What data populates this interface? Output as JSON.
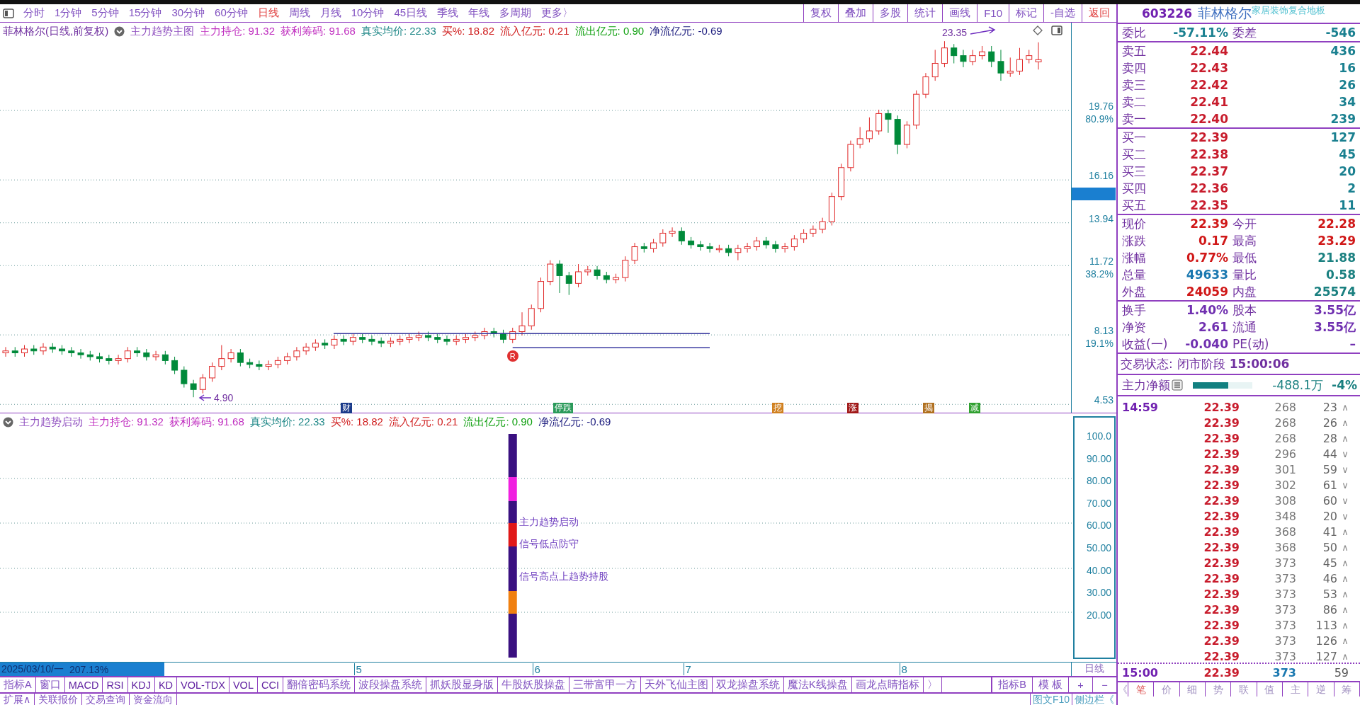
{
  "toolbar": {
    "periods": [
      {
        "label": "分时",
        "selected": false
      },
      {
        "label": "1分钟",
        "selected": false
      },
      {
        "label": "5分钟",
        "selected": false
      },
      {
        "label": "15分钟",
        "selected": false
      },
      {
        "label": "30分钟",
        "selected": false
      },
      {
        "label": "60分钟",
        "selected": false
      },
      {
        "label": "日线",
        "selected": true
      },
      {
        "label": "周线",
        "selected": false
      },
      {
        "label": "月线",
        "selected": false
      },
      {
        "label": "10分钟",
        "selected": false
      },
      {
        "label": "45日线",
        "selected": false
      },
      {
        "label": "季线",
        "selected": false
      },
      {
        "label": "年线",
        "selected": false
      },
      {
        "label": "多周期",
        "selected": false
      },
      {
        "label": "更多〉",
        "selected": false
      }
    ],
    "buttons": [
      {
        "label": "复权",
        "kind": "normal"
      },
      {
        "label": "叠加",
        "kind": "normal"
      },
      {
        "label": "多股",
        "kind": "normal"
      },
      {
        "label": "统计",
        "kind": "normal"
      },
      {
        "label": "画线",
        "kind": "normal"
      },
      {
        "label": "F10",
        "kind": "normal"
      },
      {
        "label": "标记",
        "kind": "normal"
      },
      {
        "label": "-自选",
        "kind": "normal"
      },
      {
        "label": "返回",
        "kind": "back"
      }
    ]
  },
  "stock": {
    "code": "603226",
    "name": "菲林格尔",
    "sector": "家居装饰复合地板"
  },
  "main_chart": {
    "title": "菲林格尔(日线,前复权)",
    "indicator": "主力趋势主图",
    "values": [
      {
        "label": "主力持仓:",
        "value": "91.32",
        "color": "#c030c0"
      },
      {
        "label": "获利筹码:",
        "value": "91.68",
        "color": "#c030c0"
      },
      {
        "label": "真实均价:",
        "value": "22.33",
        "color": "#208888"
      },
      {
        "label": "买%:",
        "value": "18.82",
        "color": "#d02020"
      },
      {
        "label": "流入亿元:",
        "value": "0.21",
        "color": "#d02020"
      },
      {
        "label": "流出亿元:",
        "value": "0.90",
        "color": "#10a010"
      },
      {
        "label": "净流亿元:",
        "value": "-0.69",
        "color": "#202080"
      }
    ],
    "chart_data": {
      "type": "candlestick",
      "ylim": [
        4.1,
        24.31
      ],
      "yticks": [
        {
          "value": 19.76,
          "label": "19.76"
        },
        {
          "value": 16.16,
          "label": "16.16"
        },
        {
          "value": 13.94,
          "label": "13.94"
        },
        {
          "value": 11.72,
          "label": "11.72"
        },
        {
          "value": 8.13,
          "label": "8.13"
        },
        {
          "value": 4.53,
          "label": "4.53"
        }
      ],
      "grid": true,
      "ohlc": [
        [
          7.2,
          7.5,
          7.0,
          7.3
        ],
        [
          7.3,
          7.5,
          7.0,
          7.2
        ],
        [
          7.2,
          7.6,
          7.0,
          7.4
        ],
        [
          7.4,
          7.6,
          7.1,
          7.3
        ],
        [
          7.3,
          7.7,
          7.1,
          7.5
        ],
        [
          7.5,
          7.7,
          7.2,
          7.4
        ],
        [
          7.4,
          7.6,
          7.1,
          7.3
        ],
        [
          7.3,
          7.5,
          7.0,
          7.2
        ],
        [
          7.2,
          7.4,
          6.9,
          7.1
        ],
        [
          7.1,
          7.3,
          6.8,
          7.0
        ],
        [
          7.0,
          7.2,
          6.7,
          6.9
        ],
        [
          6.9,
          7.1,
          6.6,
          6.8
        ],
        [
          6.8,
          7.1,
          6.6,
          6.9
        ],
        [
          6.9,
          7.5,
          6.7,
          7.3
        ],
        [
          7.3,
          7.5,
          7.0,
          7.2
        ],
        [
          7.2,
          7.4,
          6.8,
          7.0
        ],
        [
          7.0,
          7.3,
          6.8,
          7.1
        ],
        [
          7.1,
          7.3,
          6.6,
          6.8
        ],
        [
          6.8,
          7.0,
          6.1,
          6.3
        ],
        [
          6.3,
          6.5,
          5.4,
          5.6
        ],
        [
          5.6,
          5.8,
          4.9,
          5.3
        ],
        [
          5.3,
          6.1,
          5.1,
          5.9
        ],
        [
          5.9,
          6.7,
          5.7,
          6.5
        ],
        [
          6.5,
          7.6,
          6.3,
          6.9
        ],
        [
          6.9,
          7.4,
          6.7,
          7.2
        ],
        [
          7.2,
          7.4,
          6.5,
          6.7
        ],
        [
          6.7,
          6.9,
          6.4,
          6.6
        ],
        [
          6.6,
          6.8,
          6.3,
          6.5
        ],
        [
          6.5,
          6.8,
          6.3,
          6.6
        ],
        [
          6.6,
          7.0,
          6.4,
          6.8
        ],
        [
          6.8,
          7.2,
          6.6,
          7.0
        ],
        [
          7.0,
          7.5,
          6.8,
          7.3
        ],
        [
          7.3,
          7.7,
          7.1,
          7.5
        ],
        [
          7.5,
          7.9,
          7.3,
          7.7
        ],
        [
          7.7,
          7.9,
          7.4,
          7.6
        ],
        [
          7.6,
          8.1,
          7.4,
          7.9
        ],
        [
          7.9,
          8.1,
          7.6,
          7.8
        ],
        [
          7.8,
          8.2,
          7.6,
          8.0
        ],
        [
          8.0,
          8.2,
          7.7,
          7.9
        ],
        [
          7.9,
          8.1,
          7.6,
          7.8
        ],
        [
          7.8,
          8.0,
          7.5,
          7.7
        ],
        [
          7.7,
          8.0,
          7.5,
          7.8
        ],
        [
          7.8,
          8.1,
          7.6,
          7.9
        ],
        [
          7.9,
          8.2,
          7.7,
          8.0
        ],
        [
          8.0,
          8.3,
          7.8,
          8.1
        ],
        [
          8.1,
          8.3,
          7.8,
          8.0
        ],
        [
          8.0,
          8.2,
          7.7,
          7.9
        ],
        [
          7.9,
          8.1,
          7.6,
          7.8
        ],
        [
          7.8,
          8.1,
          7.6,
          7.9
        ],
        [
          7.9,
          8.2,
          7.7,
          8.0
        ],
        [
          8.0,
          8.3,
          7.8,
          8.1
        ],
        [
          8.1,
          8.5,
          7.9,
          8.3
        ],
        [
          8.3,
          8.5,
          8.0,
          8.2
        ],
        [
          8.2,
          8.4,
          7.7,
          7.9
        ],
        [
          7.9,
          8.5,
          7.7,
          8.3
        ],
        [
          8.3,
          9.3,
          8.1,
          8.6
        ],
        [
          8.6,
          9.7,
          8.4,
          9.5
        ],
        [
          9.5,
          11.1,
          9.3,
          10.9
        ],
        [
          10.9,
          12.0,
          10.7,
          11.8
        ],
        [
          11.8,
          12.0,
          10.3,
          11.2
        ],
        [
          11.2,
          11.4,
          10.2,
          10.8
        ],
        [
          10.8,
          11.8,
          10.6,
          11.4
        ],
        [
          11.4,
          11.7,
          11.2,
          11.5
        ],
        [
          11.5,
          11.7,
          11.0,
          11.2
        ],
        [
          11.2,
          11.4,
          10.8,
          11.0
        ],
        [
          11.0,
          11.3,
          10.8,
          11.1
        ],
        [
          11.1,
          12.2,
          10.9,
          12.0
        ],
        [
          12.0,
          12.9,
          11.8,
          12.7
        ],
        [
          12.7,
          12.9,
          12.4,
          12.6
        ],
        [
          12.6,
          13.1,
          12.4,
          12.9
        ],
        [
          12.9,
          13.6,
          12.7,
          13.4
        ],
        [
          13.4,
          13.7,
          13.2,
          13.5
        ],
        [
          13.5,
          13.7,
          12.8,
          13.0
        ],
        [
          13.0,
          13.2,
          12.6,
          12.8
        ],
        [
          12.8,
          13.0,
          12.5,
          12.7
        ],
        [
          12.7,
          12.9,
          12.4,
          12.6
        ],
        [
          12.6,
          12.8,
          12.4,
          12.6
        ],
        [
          12.6,
          12.8,
          12.2,
          12.4
        ],
        [
          12.4,
          12.8,
          12.0,
          12.6
        ],
        [
          12.6,
          12.9,
          12.4,
          12.7
        ],
        [
          12.7,
          13.2,
          12.5,
          13.0
        ],
        [
          13.0,
          13.2,
          12.6,
          12.8
        ],
        [
          12.8,
          13.0,
          12.4,
          12.6
        ],
        [
          12.6,
          12.9,
          12.4,
          12.7
        ],
        [
          12.7,
          13.3,
          12.5,
          13.1
        ],
        [
          13.1,
          13.6,
          12.9,
          13.4
        ],
        [
          13.4,
          13.8,
          13.2,
          13.6
        ],
        [
          13.6,
          14.2,
          13.4,
          14.0
        ],
        [
          14.0,
          15.5,
          13.8,
          15.3
        ],
        [
          15.3,
          17.0,
          15.1,
          16.8
        ],
        [
          16.8,
          18.2,
          16.6,
          18.0
        ],
        [
          18.0,
          18.9,
          17.8,
          18.3
        ],
        [
          18.3,
          19.4,
          18.1,
          18.7
        ],
        [
          18.7,
          19.8,
          18.5,
          19.6
        ],
        [
          19.6,
          19.8,
          18.6,
          19.3
        ],
        [
          19.3,
          19.5,
          17.5,
          18.0
        ],
        [
          18.0,
          19.2,
          17.8,
          19.0
        ],
        [
          19.0,
          20.8,
          18.8,
          20.6
        ],
        [
          20.6,
          21.7,
          20.4,
          21.5
        ],
        [
          21.5,
          22.9,
          21.3,
          22.2
        ],
        [
          22.2,
          23.35,
          22.0,
          23.0
        ],
        [
          23.0,
          23.2,
          22.2,
          22.6
        ],
        [
          22.6,
          22.9,
          22.0,
          22.3
        ],
        [
          22.3,
          22.9,
          22.1,
          22.6
        ],
        [
          22.6,
          23.1,
          22.4,
          22.8
        ],
        [
          22.8,
          23.1,
          22.0,
          22.3
        ],
        [
          22.3,
          22.9,
          21.3,
          21.7
        ],
        [
          21.7,
          22.5,
          21.5,
          21.8
        ],
        [
          21.8,
          23.0,
          21.6,
          22.4
        ],
        [
          22.4,
          22.9,
          22.2,
          22.6
        ],
        [
          22.28,
          23.29,
          21.88,
          22.39
        ]
      ]
    },
    "fib_levels": [
      "80.9%",
      "38.2%",
      "19.1%"
    ],
    "high_label": "23.35",
    "low_label": "4.90",
    "signal": "R",
    "markers": [
      {
        "label": "财",
        "color": "#1a3a8a"
      },
      {
        "label": "停跌",
        "color": "#2a9a5a"
      },
      {
        "label": "挖",
        "color": "#d08020"
      },
      {
        "label": "涨",
        "color": "#a01818"
      },
      {
        "label": "揭",
        "color": "#b07020"
      },
      {
        "label": "减",
        "color": "#30a030"
      }
    ]
  },
  "lower_chart": {
    "indicator": "主力趋势启动",
    "values": [
      {
        "label": "主力持仓:",
        "value": "91.32",
        "color": "#c030c0"
      },
      {
        "label": "获利筹码:",
        "value": "91.68",
        "color": "#c030c0"
      },
      {
        "label": "真实均价:",
        "value": "22.33",
        "color": "#208888"
      },
      {
        "label": "买%:",
        "value": "18.82",
        "color": "#d02020"
      },
      {
        "label": "流入亿元:",
        "value": "0.21",
        "color": "#d02020"
      },
      {
        "label": "流出亿元:",
        "value": "0.90",
        "color": "#10a010"
      },
      {
        "label": "净流亿元:",
        "value": "-0.69",
        "color": "#202080"
      }
    ],
    "signals": [
      "主力趋势启动",
      "信号低点防守",
      "信号高点上趋势持股"
    ],
    "axis": [
      "100.0",
      "90.00",
      "80.00",
      "70.00",
      "60.00",
      "50.00",
      "40.00",
      "30.00",
      "20.00"
    ]
  },
  "date_bar": {
    "date": "2025/03/10/一",
    "value": "207.13%",
    "months": [
      "5",
      "6",
      "7",
      "8"
    ],
    "period": "日线"
  },
  "indicator_tabs": [
    "指标A",
    "窗口",
    "MACD",
    "RSI",
    "KDJ",
    "KD",
    "VOL-TDX",
    "VOL",
    "CCI",
    "翻倍密码系统",
    "波段操盘系统",
    "抓妖股显身版",
    "牛股妖股操盘",
    "三带富甲一方",
    "天外飞仙主图",
    "双龙操盘系统",
    "魔法K线操盘",
    "画龙点睛指标",
    "〉"
  ],
  "indicator_buttons": [
    "指标B",
    "模 板",
    "+",
    "−"
  ],
  "bottom_links": [
    "扩展∧",
    "关联报价",
    "交易查询",
    "资金流向"
  ],
  "side_links": [
    "图文F10",
    "侧边栏《"
  ],
  "quote": {
    "ratio": {
      "label": "委比",
      "value": "-57.11%",
      "label2": "委差",
      "value2": "-546"
    },
    "asks": [
      {
        "label": "卖五",
        "price": "22.44",
        "volume": "436"
      },
      {
        "label": "卖四",
        "price": "22.43",
        "volume": "16"
      },
      {
        "label": "卖三",
        "price": "22.42",
        "volume": "26"
      },
      {
        "label": "卖二",
        "price": "22.41",
        "volume": "34"
      },
      {
        "label": "卖一",
        "price": "22.40",
        "volume": "239"
      }
    ],
    "bids": [
      {
        "label": "买一",
        "price": "22.39",
        "volume": "127"
      },
      {
        "label": "买二",
        "price": "22.38",
        "volume": "45"
      },
      {
        "label": "买三",
        "price": "22.37",
        "volume": "20"
      },
      {
        "label": "买四",
        "price": "22.36",
        "volume": "2"
      },
      {
        "label": "买五",
        "price": "22.35",
        "volume": "11"
      }
    ],
    "stats": [
      [
        {
          "label": "现价",
          "value": "22.39",
          "color": "#d01818"
        },
        {
          "label": "今开",
          "value": "22.28",
          "color": "#d01818"
        }
      ],
      [
        {
          "label": "涨跌",
          "value": "0.17",
          "color": "#d01818"
        },
        {
          "label": "最高",
          "value": "23.29",
          "color": "#d01818"
        }
      ],
      [
        {
          "label": "涨幅",
          "value": "0.77%",
          "color": "#d01818"
        },
        {
          "label": "最低",
          "value": "21.88",
          "color": "#1a8080"
        }
      ],
      [
        {
          "label": "总量",
          "value": "49633",
          "color": "#1a78b0"
        },
        {
          "label": "量比",
          "value": "0.58",
          "color": "#1a8080"
        }
      ],
      [
        {
          "label": "外盘",
          "value": "24059",
          "color": "#d01818"
        },
        {
          "label": "内盘",
          "value": "25574",
          "color": "#1a8080"
        }
      ]
    ],
    "capital": [
      {
        "label": "换手",
        "value": "1.40%",
        "label2": "股本",
        "value2": "3.55亿"
      },
      {
        "label": "净资",
        "value": "2.61",
        "label2": "流通",
        "value2": "3.55亿"
      },
      {
        "label": "收益(一)",
        "value": "-0.040",
        "label2": "PE(动)",
        "value2": "–"
      }
    ],
    "status_label": "交易状态:",
    "status_value": "闭市阶段",
    "status_time": "15:00:06",
    "net": {
      "label": "主力净额",
      "level": 0.6,
      "amount": "-488.1万",
      "percent": "-4%"
    },
    "ticks": [
      {
        "time": "14:59",
        "price": "22.39",
        "volume": "268",
        "count": "23",
        "dir": "∧"
      },
      {
        "price": "22.39",
        "volume": "268",
        "count": "26",
        "dir": "∧"
      },
      {
        "price": "22.39",
        "volume": "268",
        "count": "28",
        "dir": "∧"
      },
      {
        "price": "22.39",
        "volume": "296",
        "count": "44",
        "dir": "∨"
      },
      {
        "price": "22.39",
        "volume": "301",
        "count": "59",
        "dir": "∨"
      },
      {
        "price": "22.39",
        "volume": "302",
        "count": "61",
        "dir": "∨"
      },
      {
        "price": "22.39",
        "volume": "308",
        "count": "60",
        "dir": "∨"
      },
      {
        "price": "22.39",
        "volume": "348",
        "count": "20",
        "dir": "∨"
      },
      {
        "price": "22.39",
        "volume": "368",
        "count": "41",
        "dir": "∧"
      },
      {
        "price": "22.39",
        "volume": "368",
        "count": "50",
        "dir": "∧"
      },
      {
        "price": "22.39",
        "volume": "373",
        "count": "45",
        "dir": "∧"
      },
      {
        "price": "22.39",
        "volume": "373",
        "count": "46",
        "dir": "∧"
      },
      {
        "price": "22.39",
        "volume": "373",
        "count": "53",
        "dir": "∧"
      },
      {
        "price": "22.39",
        "volume": "373",
        "count": "86",
        "dir": "∧"
      },
      {
        "price": "22.39",
        "volume": "373",
        "count": "113",
        "dir": "∧"
      },
      {
        "price": "22.39",
        "volume": "373",
        "count": "126",
        "dir": "∧"
      },
      {
        "price": "22.39",
        "volume": "373",
        "count": "127",
        "dir": "∧"
      }
    ],
    "last_tick": {
      "time": "15:00",
      "price": "22.39",
      "volume": "373",
      "count": "59"
    },
    "panel_tabs": [
      {
        "label": "《",
        "selected": false
      },
      {
        "label": "笔",
        "selected": true
      },
      {
        "label": "价",
        "selected": false
      },
      {
        "label": "细",
        "selected": false
      },
      {
        "label": "势",
        "selected": false
      },
      {
        "label": "联",
        "selected": false
      },
      {
        "label": "值",
        "selected": false
      },
      {
        "label": "主",
        "selected": false
      },
      {
        "label": "逆",
        "selected": false
      },
      {
        "label": "筹",
        "selected": false
      }
    ]
  }
}
